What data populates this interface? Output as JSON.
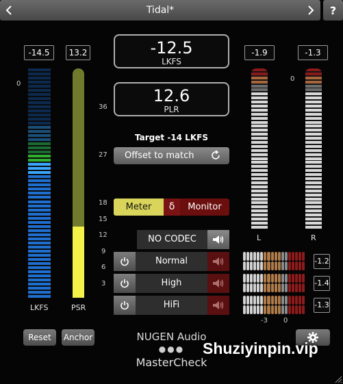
{
  "header": {
    "preset_name": "Tidal*",
    "prev_icon": "chevron-left-icon",
    "next_icon": "chevron-right-icon",
    "help_label": "?"
  },
  "left_meters": {
    "lkfs_value": "-14.5",
    "psr_value": "13.2",
    "lkfs_scale_top": "0",
    "lkfs_label": "LKFS",
    "psr_label": "PSR",
    "psr_level_fraction": 0.31
  },
  "center_scale": [
    "36",
    "27",
    "18",
    "15",
    "12",
    "9",
    "6",
    "3"
  ],
  "readouts": {
    "loudness_value": "-12.5",
    "loudness_unit": "LKFS",
    "plr_value": "12.6",
    "plr_unit": "PLR"
  },
  "target": {
    "label": "Target -14 LKFS",
    "offset_button": "Offset to match"
  },
  "mode": {
    "meter_label": "Meter",
    "delta_label": "δ",
    "monitor_label": "Monitor",
    "active": "Meter"
  },
  "codecs": [
    {
      "label": "NO CODEC",
      "active": true
    },
    {
      "label": "Normal",
      "active": false
    },
    {
      "label": "High",
      "active": false
    },
    {
      "label": "HiFi",
      "active": false
    }
  ],
  "lr_meters": {
    "left_value": "-1.9",
    "right_value": "-1.3",
    "right_scale_top": "0",
    "left_label": "L",
    "right_label": "R"
  },
  "codec_peaks": {
    "normal": "-1.2",
    "high": "-1.4",
    "hifi": "-1.3",
    "scale_left": "-3",
    "scale_right": "0"
  },
  "footer": {
    "reset_label": "Reset",
    "anchor_label": "Anchor",
    "brand": "NUGEN Audio",
    "dots": "●●●",
    "product": "MasterCheck",
    "settings_icon": "gear-icon"
  },
  "watermark": "Shuziyinpin.vip",
  "colors": {
    "accent_yellow": "#d9d55a",
    "monitor_red": "#6a0e0e",
    "meter_blue": "#1f6fd0",
    "meter_green": "#2fae2f"
  }
}
